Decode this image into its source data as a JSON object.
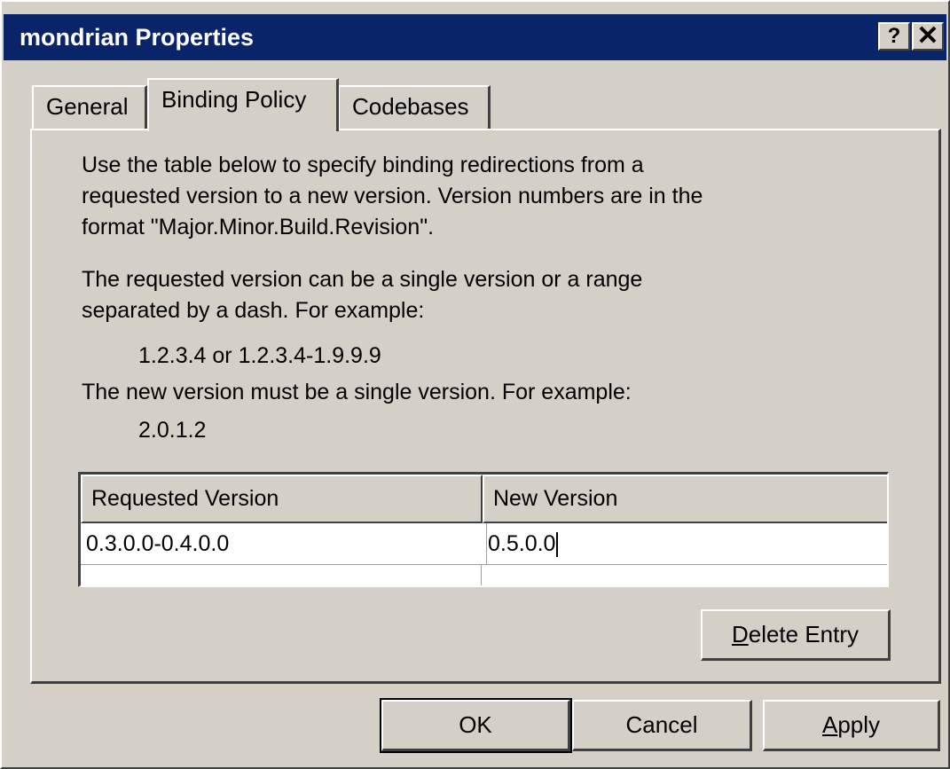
{
  "window": {
    "title": "mondrian Properties",
    "help_glyph": "?",
    "close_glyph": "✕"
  },
  "tabs": [
    {
      "label": "General"
    },
    {
      "label": "Binding Policy"
    },
    {
      "label": "Codebases"
    }
  ],
  "content": {
    "intro_lines": [
      "Use the table below to specify binding redirections from a",
      "requested version to a new version.  Version numbers are in the",
      "format \"Major.Minor.Build.Revision\"."
    ],
    "requested_lines": [
      "The requested version can be a single version or a range",
      "separated by a dash.  For example:"
    ],
    "requested_example": "1.2.3.4 or 1.2.3.4-1.9.9.9",
    "new_line": "The new version must be a single version.  For example:",
    "new_example": "2.0.1.2"
  },
  "grid": {
    "headers": [
      "Requested Version",
      "New Version"
    ],
    "rows": [
      {
        "requested": "0.3.0.0-0.4.0.0",
        "new": "0.5.0.0"
      }
    ]
  },
  "buttons": {
    "delete_entry": {
      "hotkey": "D",
      "rest": "elete Entry"
    },
    "ok": "OK",
    "cancel": "Cancel",
    "apply": {
      "hotkey": "A",
      "rest": "pply"
    }
  }
}
